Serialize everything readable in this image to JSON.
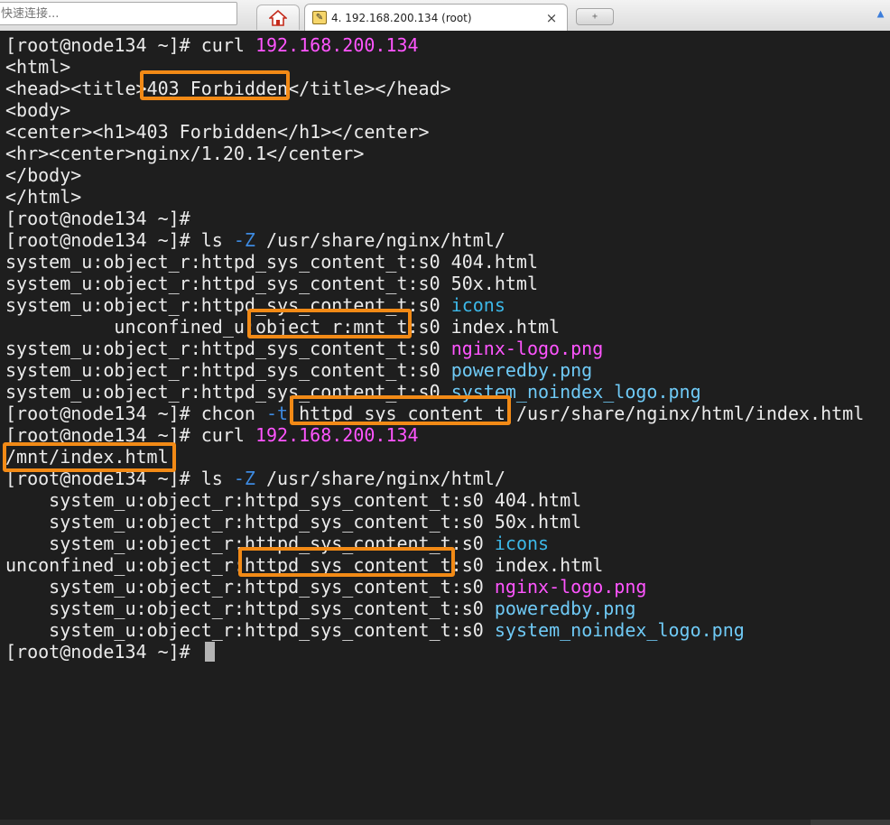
{
  "toolbar": {
    "quick_connect_placeholder": "快速连接...",
    "home_icon": "home-icon",
    "session_tab_title": "4. 192.168.200.134 (root)",
    "session_tab_icon": "terminal-session-icon",
    "close_glyph": "×",
    "new_tab_glyph": "+"
  },
  "terminal": {
    "lines": [
      [
        {
          "t": "[root@node134 ~]# curl "
        },
        {
          "t": "192.168.200.134",
          "c": "magenta"
        }
      ],
      [
        {
          "t": "<html>"
        }
      ],
      [
        {
          "t": "<head><title>403 Forbidden</title></head>"
        }
      ],
      [
        {
          "t": "<body>"
        }
      ],
      [
        {
          "t": "<center><h1>403 Forbidden</h1></center>"
        }
      ],
      [
        {
          "t": "<hr><center>nginx/1.20.1</center>"
        }
      ],
      [
        {
          "t": "</body>"
        }
      ],
      [
        {
          "t": "</html>"
        }
      ],
      [
        {
          "t": "[root@node134 ~]#"
        }
      ],
      [
        {
          "t": "[root@node134 ~]# ls "
        },
        {
          "t": "-Z",
          "c": "blue"
        },
        {
          "t": " /usr/share/nginx/html/"
        }
      ],
      [
        {
          "t": "system_u:object_r:httpd_sys_content_t:s0 404.html"
        }
      ],
      [
        {
          "t": "system_u:object_r:httpd_sys_content_t:s0 50x.html"
        }
      ],
      [
        {
          "t": "system_u:object_r:httpd_sys_content_t:s0 "
        },
        {
          "t": "icons",
          "c": "cyan"
        }
      ],
      [
        {
          "t": "          unconfined_u:object_r:mnt_t:s0 index.html"
        }
      ],
      [
        {
          "t": "system_u:object_r:httpd_sys_content_t:s0 "
        },
        {
          "t": "nginx-logo.png",
          "c": "magenta"
        }
      ],
      [
        {
          "t": "system_u:object_r:httpd_sys_content_t:s0 "
        },
        {
          "t": "poweredby.png",
          "c": "ltcyan"
        }
      ],
      [
        {
          "t": "system_u:object_r:httpd_sys_content_t:s0 "
        },
        {
          "t": "system_noindex_logo.png",
          "c": "ltcyan"
        }
      ],
      [
        {
          "t": "[root@node134 ~]# chcon "
        },
        {
          "t": "-t",
          "c": "blue"
        },
        {
          "t": " httpd_sys_content_t /usr/share/nginx/html/index.html"
        }
      ],
      [
        {
          "t": "[root@node134 ~]# curl "
        },
        {
          "t": "192.168.200.134",
          "c": "magenta"
        }
      ],
      [
        {
          "t": "/mnt/index.html"
        }
      ],
      [
        {
          "t": "[root@node134 ~]# ls "
        },
        {
          "t": "-Z",
          "c": "blue"
        },
        {
          "t": " /usr/share/nginx/html/"
        }
      ],
      [
        {
          "t": "    system_u:object_r:httpd_sys_content_t:s0 404.html"
        }
      ],
      [
        {
          "t": "    system_u:object_r:httpd_sys_content_t:s0 50x.html"
        }
      ],
      [
        {
          "t": "    system_u:object_r:httpd_sys_content_t:s0 "
        },
        {
          "t": "icons",
          "c": "cyan"
        }
      ],
      [
        {
          "t": "unconfined_u:object_r:httpd_sys_content_t:s0 index.html"
        }
      ],
      [
        {
          "t": "    system_u:object_r:httpd_sys_content_t:s0 "
        },
        {
          "t": "nginx-logo.png",
          "c": "magenta"
        }
      ],
      [
        {
          "t": "    system_u:object_r:httpd_sys_content_t:s0 "
        },
        {
          "t": "poweredby.png",
          "c": "ltcyan"
        }
      ],
      [
        {
          "t": "    system_u:object_r:httpd_sys_content_t:s0 "
        },
        {
          "t": "system_noindex_logo.png",
          "c": "ltcyan"
        }
      ],
      [
        {
          "t": "[root@node134 ~]# "
        }
      ]
    ],
    "colors": {
      "background": "#1e1e1e",
      "foreground": "#ebebeb",
      "magenta": "#ff55ff",
      "cyan": "#3cb8e8",
      "ltcyan": "#6fcaf6",
      "blue": "#3d8ae0",
      "highlight": "#f28a16"
    }
  }
}
